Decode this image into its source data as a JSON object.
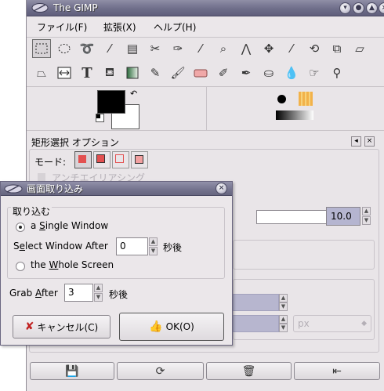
{
  "toolbox": {
    "title": "The GIMP",
    "menu": [
      "ファイル(F)",
      "拡張(X)",
      "ヘルプ(H)"
    ],
    "tool_icons": [
      "rect-select-icon",
      "ellipse-select-icon",
      "lasso-icon",
      "fuzzy-select-icon",
      "color-select-icon",
      "scissors-icon",
      "paths-icon",
      "color-picker-icon",
      "zoom-icon",
      "measure-icon",
      "move-icon",
      "crop-icon",
      "rotate-icon",
      "scale-icon",
      "shear-icon",
      "perspective-icon",
      "flip-icon",
      "text-icon",
      "bucket-fill-icon",
      "blend-icon",
      "pencil-icon",
      "paintbrush-icon",
      "eraser-icon",
      "airbrush-icon",
      "ink-icon",
      "clone-icon",
      "blur-icon",
      "smudge-icon",
      "dodge-burn-icon"
    ],
    "options_title": "矩形選択 オプション",
    "mode_label": "モード:",
    "antialias_label": "アンチエイリアシング",
    "feather_value": "10.0",
    "unit_value": "px"
  },
  "dialog": {
    "title": "画面取り込み",
    "group_label": "取り込む",
    "single_window": {
      "prefix": "a ",
      "u": "S",
      "rest": "ingle Window"
    },
    "select_after": {
      "u": "e",
      "pre": "S",
      "rest": "lect Window After"
    },
    "select_after_value": "0",
    "seconds": "秒後",
    "whole_screen": {
      "pre": "the ",
      "u": "W",
      "rest": "hole Screen"
    },
    "grab_after": {
      "pre": "Grab ",
      "u": "A",
      "rest": "fter"
    },
    "grab_after_value": "3",
    "cancel_label": "キャンセル(C)",
    "ok_label": "OK(O)"
  },
  "colors": {
    "titlebar": "#6f6e8a",
    "window_bg": "#e9e5e8",
    "fg_color": "#000000",
    "bg_color": "#ffffff",
    "selected_mode": "#e35050"
  }
}
